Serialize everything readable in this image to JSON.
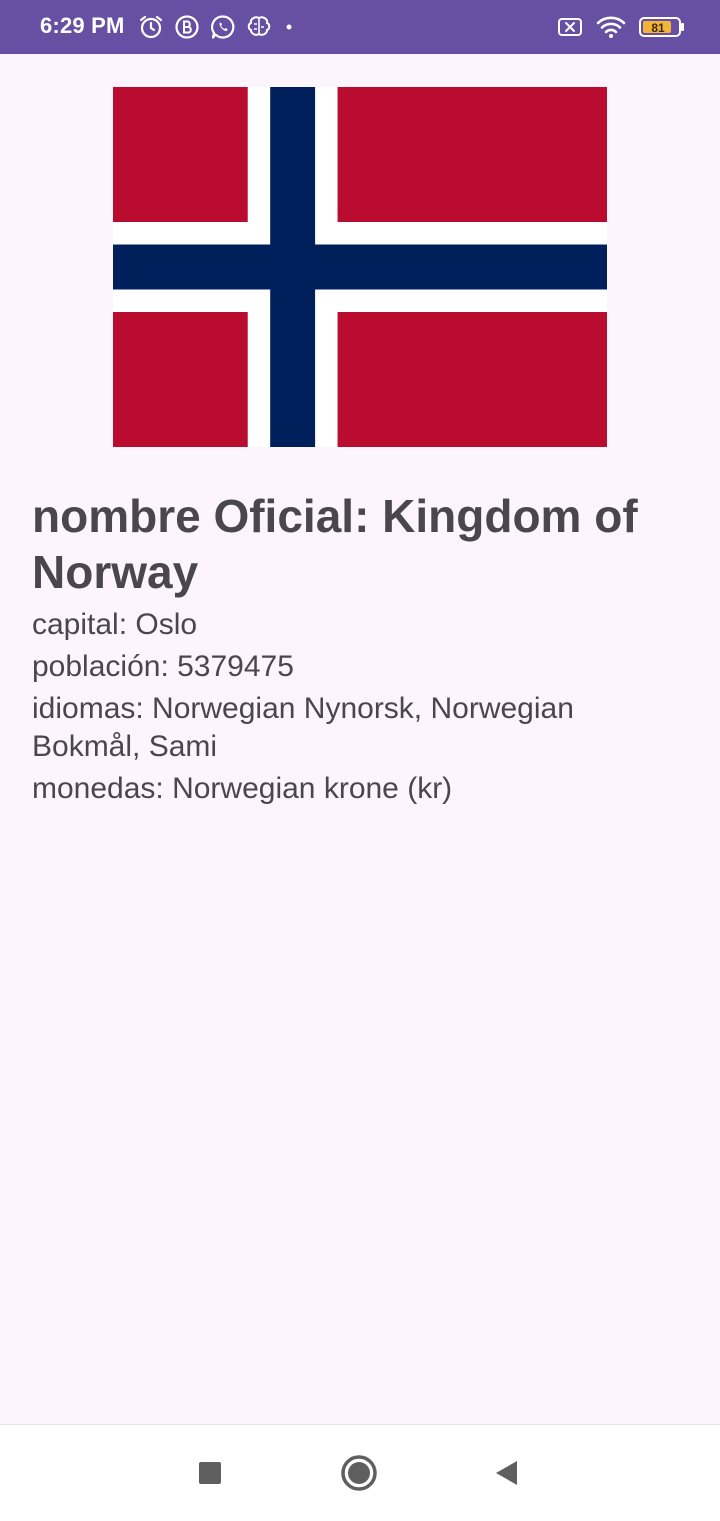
{
  "status_bar": {
    "time": "6:29 PM",
    "battery_level": "81",
    "background_color": "#6750a4",
    "left_icons": [
      "alarm-icon",
      "b-badge-icon",
      "whatsapp-icon",
      "brain-icon",
      "dot-icon"
    ],
    "right_icons": [
      "sim-x-icon",
      "wifi-icon",
      "battery-icon"
    ]
  },
  "country": {
    "flag_icon": "norway-flag",
    "flag_colors": {
      "red": "#ba0c2f",
      "white": "#ffffff",
      "blue": "#00205b"
    },
    "official_name": "nombre Oficial: Kingdom of Norway",
    "capital": "capital: Oslo",
    "population": "población: 5379475",
    "languages": "idiomas: Norwegian Nynorsk, Norwegian Bokmål, Sami",
    "currencies": "monedas: Norwegian krone (kr)"
  },
  "nav_bar": {
    "buttons": [
      "recents-square-icon",
      "home-circle-icon",
      "back-triangle-icon"
    ]
  }
}
